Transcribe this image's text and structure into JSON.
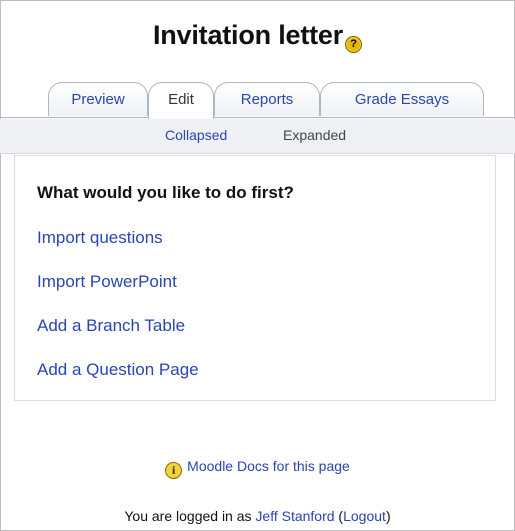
{
  "page": {
    "title": "Invitation letter",
    "help_glyph": "?"
  },
  "tabs": [
    {
      "label": "Preview",
      "selected": false
    },
    {
      "label": "Edit",
      "selected": true
    },
    {
      "label": "Reports",
      "selected": false
    },
    {
      "label": "Grade Essays",
      "selected": false
    }
  ],
  "subtabs": {
    "collapsed": "Collapsed",
    "expanded": "Expanded"
  },
  "main": {
    "question": "What would you like to do first?",
    "actions": [
      "Import questions",
      "Import PowerPoint",
      "Add a Branch Table",
      "Add a Question Page"
    ]
  },
  "footer": {
    "docs_icon_glyph": "i",
    "docs_link": "Moodle Docs for this page",
    "logged_in_prefix": "You are logged in as ",
    "user_name": "Jeff Stanford",
    "paren_open": " (",
    "logout": "Logout",
    "paren_close": ")"
  },
  "colors": {
    "link": "#2a45b0",
    "icon_yellow": "#e8b800"
  }
}
